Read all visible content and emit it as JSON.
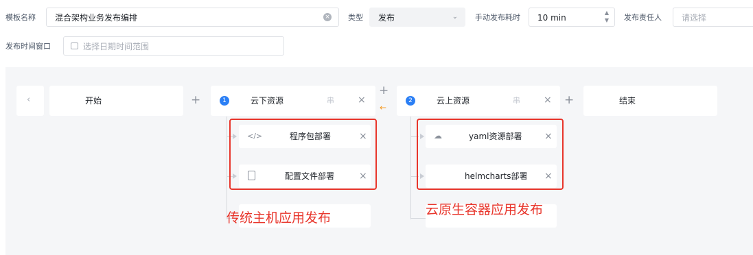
{
  "form": {
    "template_name_label": "模板名称",
    "template_name_value": "混合架构业务发布编排",
    "type_label": "类型",
    "type_value": "发布",
    "manual_time_label": "手动发布耗时",
    "manual_time_value": "10",
    "manual_time_unit": "min",
    "owner_label": "发布责任人",
    "owner_placeholder": "请选择",
    "window_label": "发布时间窗口",
    "window_placeholder": "选择日期时间范围"
  },
  "flow": {
    "start_label": "开始",
    "end_label": "结束",
    "stage1": {
      "index": "1",
      "title": "云下资源",
      "mode": "串",
      "steps": [
        "程序包部署",
        "配置文件部署"
      ]
    },
    "stage2": {
      "index": "2",
      "title": "云上资源",
      "mode": "串",
      "steps": [
        "yaml资源部署",
        "helmcharts部署"
      ]
    }
  },
  "annotations": {
    "left": "传统主机应用发布",
    "right": "云原生容器应用发布"
  },
  "colors": {
    "accent": "#2b7ff5",
    "highlight": "#e8352b",
    "swap_arrow": "#f59a23"
  }
}
